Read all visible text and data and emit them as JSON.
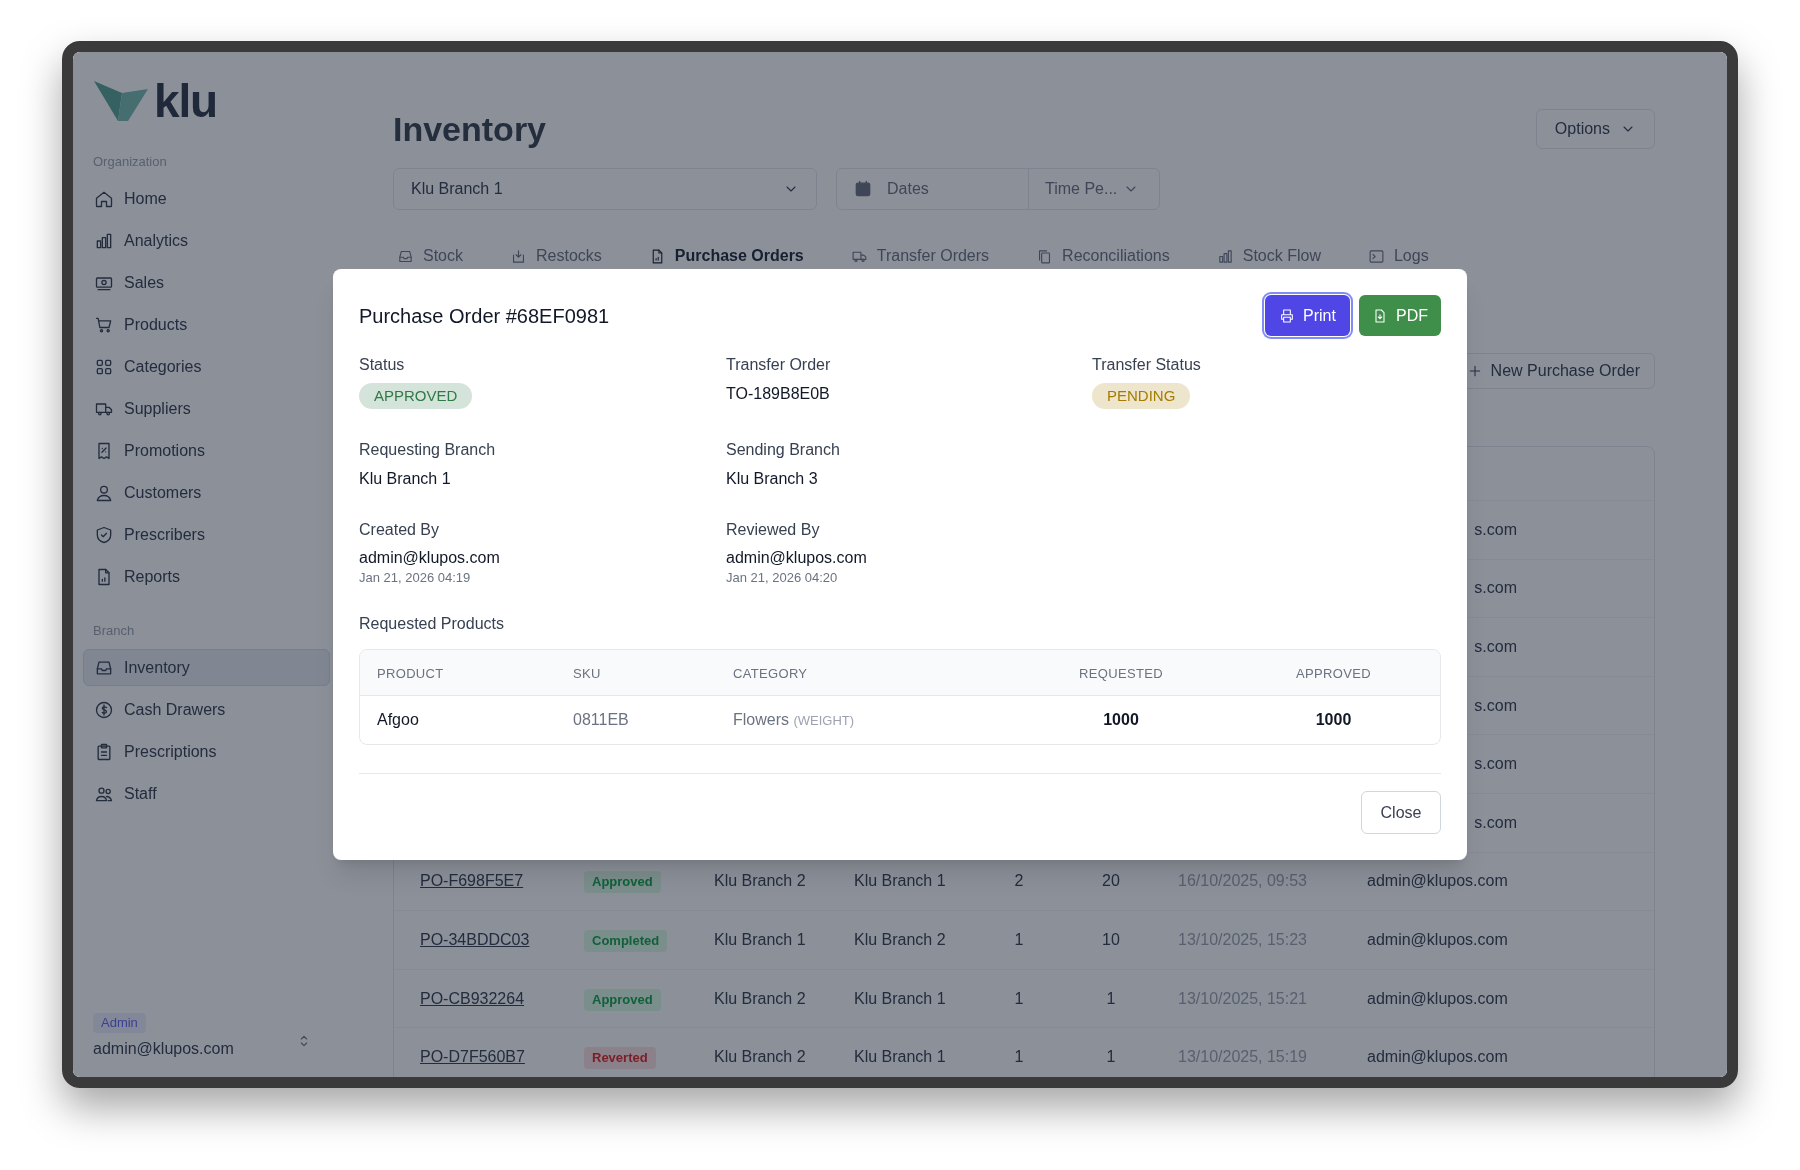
{
  "logo": {
    "text": "klu"
  },
  "sidebar": {
    "sections": [
      {
        "title": "Organization",
        "items": [
          {
            "label": "Home",
            "selected": false
          },
          {
            "label": "Analytics",
            "selected": false
          },
          {
            "label": "Sales",
            "selected": false
          },
          {
            "label": "Products",
            "selected": false
          },
          {
            "label": "Categories",
            "selected": false
          },
          {
            "label": "Suppliers",
            "selected": false
          },
          {
            "label": "Promotions",
            "selected": false
          },
          {
            "label": "Customers",
            "selected": false
          },
          {
            "label": "Prescribers",
            "selected": false
          },
          {
            "label": "Reports",
            "selected": false
          }
        ]
      },
      {
        "title": "Branch",
        "items": [
          {
            "label": "Inventory",
            "selected": true
          },
          {
            "label": "Cash Drawers",
            "selected": false
          },
          {
            "label": "Prescriptions",
            "selected": false
          },
          {
            "label": "Staff",
            "selected": false
          }
        ]
      }
    ],
    "user": {
      "role": "Admin",
      "email": "admin@klupos.com"
    }
  },
  "page": {
    "title": "Inventory",
    "options_button": "Options",
    "branch_select": "Klu Branch 1",
    "date_field": {
      "placeholder": "Dates"
    },
    "period_select": "Time Pe...",
    "tabs": [
      {
        "label": "Stock",
        "selected": false
      },
      {
        "label": "Restocks",
        "selected": false
      },
      {
        "label": "Purchase Orders",
        "selected": true
      },
      {
        "label": "Transfer Orders",
        "selected": false
      },
      {
        "label": "Reconciliations",
        "selected": false
      },
      {
        "label": "Stock Flow",
        "selected": false
      },
      {
        "label": "Logs",
        "selected": false
      }
    ],
    "new_button": "New Purchase Order"
  },
  "table": {
    "rows": [
      {
        "column_8": "s.com"
      },
      {
        "column_8": "s.com"
      },
      {
        "column_8": "s.com"
      },
      {
        "column_8": "s.com"
      },
      {
        "column_8": "s.com"
      },
      {
        "column_8": "s.com"
      },
      {
        "column_1": "PO-F698F5E7",
        "column_2": {
          "label": "Approved",
          "kind": "success"
        },
        "column_3": "Klu Branch 2",
        "column_4": "Klu Branch 1",
        "column_5": "2",
        "column_6": "20",
        "column_7": "16/10/2025, 09:53",
        "column_8": "admin@klupos.com"
      },
      {
        "column_1": "PO-34BDDC03",
        "column_2": {
          "label": "Completed",
          "kind": "success"
        },
        "column_3": "Klu Branch 1",
        "column_4": "Klu Branch 2",
        "column_5": "1",
        "column_6": "10",
        "column_7": "13/10/2025, 15:23",
        "column_8": "admin@klupos.com"
      },
      {
        "column_1": "PO-CB932264",
        "column_2": {
          "label": "Approved",
          "kind": "success"
        },
        "column_3": "Klu Branch 2",
        "column_4": "Klu Branch 1",
        "column_5": "1",
        "column_6": "1",
        "column_7": "13/10/2025, 15:21",
        "column_8": "admin@klupos.com"
      },
      {
        "column_1": "PO-D7F560B7",
        "column_2": {
          "label": "Reverted",
          "kind": "danger"
        },
        "column_3": "Klu Branch 2",
        "column_4": "Klu Branch 1",
        "column_5": "1",
        "column_6": "1",
        "column_7": "13/10/2025, 15:19",
        "column_8": "admin@klupos.com"
      }
    ]
  },
  "modal": {
    "title": "Purchase Order #68EF0981",
    "print_button": "Print",
    "pdf_button": "PDF",
    "fields": [
      {
        "label": "Status",
        "kind": "badge",
        "value": "APPROVED",
        "color": "#2f7a45"
      },
      {
        "label": "Transfer Order",
        "kind": "text",
        "value": "TO-189B8E0B"
      },
      {
        "label": "Transfer Status",
        "kind": "badge",
        "value": "PENDING",
        "color": "#a67c00"
      },
      {
        "label": "Requesting Branch",
        "kind": "text",
        "value": "Klu Branch 1"
      },
      {
        "label": "Sending Branch",
        "kind": "text",
        "value": "Klu Branch 3"
      },
      {
        "label": "Created By",
        "kind": "user",
        "value": "admin@klupos.com",
        "date": "Jan 21, 2026 04:19"
      },
      {
        "label": "Reviewed By",
        "kind": "user",
        "value": "admin@klupos.com",
        "date": "Jan 21, 2026 04:20"
      }
    ],
    "products_title": "Requested Products",
    "products": {
      "columns": [
        "PRODUCT",
        "SKU",
        "CATEGORY",
        "REQUESTED",
        "APPROVED"
      ],
      "rows": [
        {
          "product": "Afgoo",
          "sku": "0811EB",
          "category": "Flowers",
          "unit": "(WEIGHT)",
          "requested": "1000",
          "approved": "1000"
        }
      ]
    },
    "close_button": "Close"
  }
}
